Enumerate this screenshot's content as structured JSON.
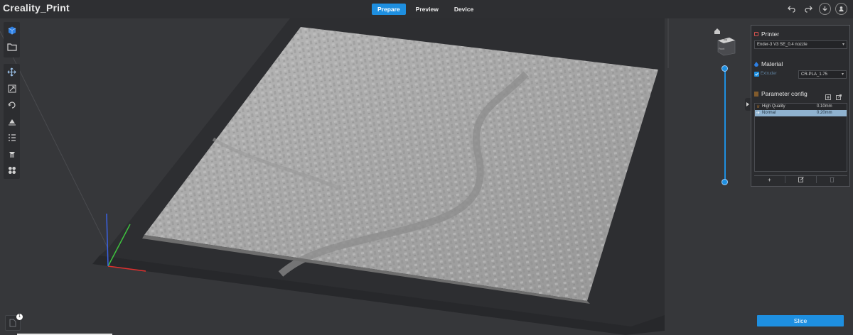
{
  "app": {
    "title": "Creality_Print"
  },
  "tabs": [
    {
      "label": "Prepare",
      "active": true
    },
    {
      "label": "Preview",
      "active": false
    },
    {
      "label": "Device",
      "active": false
    }
  ],
  "top_actions": [
    "undo-icon",
    "redo-icon",
    "download-icon",
    "user-icon"
  ],
  "left_toolbar": {
    "group1": [
      "add-model-icon",
      "open-folder-icon"
    ],
    "group2": [
      "move-icon",
      "scale-icon",
      "rotate-icon",
      "lay-flat-icon",
      "arrange-list-icon",
      "support-icon",
      "split-icon"
    ]
  },
  "view_cube": {
    "face_top": "Top",
    "face_front": "Front"
  },
  "right_panel": {
    "printer": {
      "heading": "Printer",
      "selected": "Ender-3 V3 SE_0.4 nozzle"
    },
    "material": {
      "heading": "Material",
      "extruder_label": "Extruder",
      "selected": "CR-PLA_1.75"
    },
    "parameter": {
      "heading": "Parameter config",
      "rows": [
        {
          "name": "High Quality",
          "value": "0.10mm",
          "selected": false
        },
        {
          "name": "Normal",
          "value": "0.20mm",
          "selected": true
        }
      ]
    }
  },
  "slice": {
    "label": "Slice"
  },
  "notification": {
    "count": "1"
  },
  "colors": {
    "accent": "#1e8fe0",
    "background": "#36373a",
    "panel": "#2b2c2f",
    "axis_x": "#e0302e",
    "axis_y": "#3ec23e",
    "axis_z": "#3a62e6"
  }
}
